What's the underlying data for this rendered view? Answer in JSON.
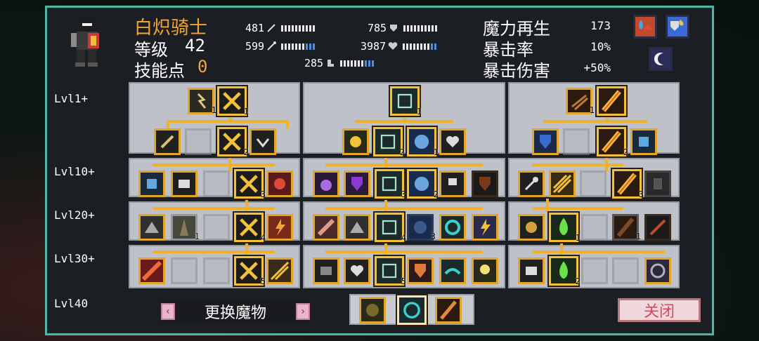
{
  "character": {
    "name": "白炽骑士",
    "level_label": "等级",
    "level": "42",
    "skill_points_label": "技能点",
    "skill_points": "0"
  },
  "stats": {
    "attack": "481",
    "magic": "599",
    "defense": "785",
    "health": "3987",
    "speed": "285"
  },
  "right_stats": {
    "mana_regen_label": "魔力再生",
    "mana_regen": "173",
    "crit_rate_label": "暴击率",
    "crit_rate": "10%",
    "crit_damage_label": "暴击伤害",
    "crit_damage": "+50%"
  },
  "level_rows": [
    "Lvl1+",
    "Lvl10+",
    "Lvl20+",
    "Lvl30+",
    "Lvl40"
  ],
  "skill_counts": {
    "t1r0a": "1",
    "t1r0b": "1",
    "t1r1c": "2",
    "t2r0": "1",
    "t2r1b": "2",
    "t2r1c": "1",
    "t3r0a": "1",
    "t3r1b": "2",
    "t1r2c": "3",
    "t2r2c": "3",
    "t2r2d": "2",
    "t3r2c": "3",
    "t1r3b": "1",
    "t1r3c": "4",
    "t2r3c": "4",
    "t2r3d": "3",
    "t3r3b": "1",
    "t3r3d": "1",
    "t1r4c": "5",
    "t2r4c": "5",
    "t3r4b": "2"
  },
  "buttons": {
    "swap_label": "更换魔物",
    "prev_arrow": "‹",
    "next_arrow": "›",
    "close_label": "关闭"
  },
  "colors": {
    "accent": "#f5a531",
    "frame": "#53b3a4",
    "link": "#f0b12a"
  }
}
